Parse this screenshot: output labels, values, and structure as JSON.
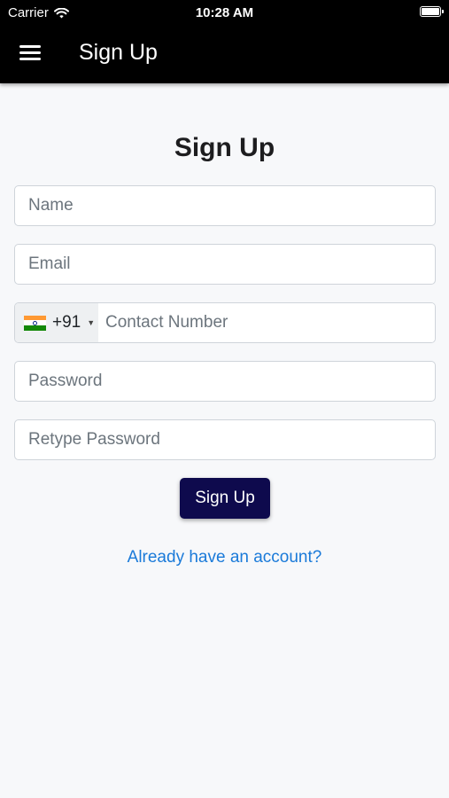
{
  "status_bar": {
    "carrier": "Carrier",
    "time": "10:28 AM"
  },
  "nav": {
    "title": "Sign Up",
    "menu_icon": "hamburger-menu-icon"
  },
  "form": {
    "heading": "Sign Up",
    "name_placeholder": "Name",
    "email_placeholder": "Email",
    "phone": {
      "country_flag": "india-flag",
      "dial_code": "+91",
      "placeholder": "Contact Number"
    },
    "password_placeholder": "Password",
    "retype_password_placeholder": "Retype Password",
    "submit_label": "Sign Up",
    "login_link": "Already have an account?"
  },
  "colors": {
    "header_bg": "#000000",
    "button_bg": "#0e0a4d",
    "link": "#1a7ad9",
    "page_bg": "#f7f8fa"
  }
}
